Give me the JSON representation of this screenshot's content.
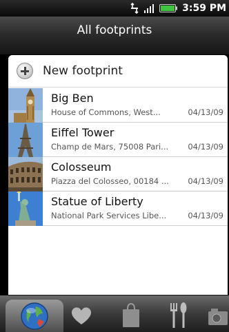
{
  "status_bar": {
    "time": "3:59 PM"
  },
  "title_bar": {
    "title": "All footprints"
  },
  "new_footprint": {
    "label": "New footprint",
    "icon": "plus-icon"
  },
  "footprints": [
    {
      "name": "Big Ben",
      "address": "House of Commons, West...",
      "date": "04/13/09"
    },
    {
      "name": "Eiffel Tower",
      "address": "Champ de Mars, 75008 Pari...",
      "date": "04/13/09"
    },
    {
      "name": "Colosseum",
      "address": "Piazza del Colosseo, 00184 ...",
      "date": "04/13/09"
    },
    {
      "name": "Statue of Liberty",
      "address": "National Park Services Libe...",
      "date": "04/13/09"
    }
  ],
  "tabs": [
    {
      "icon": "globe-icon",
      "selected": true
    },
    {
      "icon": "heart-icon",
      "selected": false
    },
    {
      "icon": "shopping-bag-icon",
      "selected": false
    },
    {
      "icon": "fork-knife-icon",
      "selected": false
    },
    {
      "icon": "camera-icon",
      "selected": false
    }
  ],
  "colors": {
    "title_text": "#ffffff",
    "accent_globe": "#2f6fc4"
  }
}
